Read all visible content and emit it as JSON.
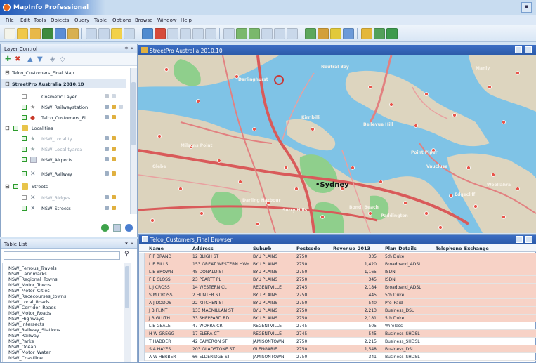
{
  "app": {
    "title": "MapInfo Professional",
    "accent": "#2b5aa8"
  },
  "menu": [
    "File",
    "Edit",
    "Tools",
    "Objects",
    "Query",
    "Table",
    "Options",
    "Browse",
    "Window",
    "Help"
  ],
  "layer_control": {
    "title": "Layer Control",
    "close_label": "✶ ×",
    "rows": [
      {
        "label": "Telco_Customers_Final Map"
      },
      {
        "label": "StreetPro Australia 2010.10"
      },
      {
        "label": "Cosmetic Layer"
      },
      {
        "label": "NSW_Railwaystation"
      },
      {
        "label": "Telco_Customers_Fi"
      },
      {
        "label": "Localities"
      },
      {
        "label": "NSW_Locality"
      },
      {
        "label": "NSW_Localityarea"
      },
      {
        "label": "NSW_Airports"
      },
      {
        "label": "NSW_Railway"
      },
      {
        "label": "Streets"
      },
      {
        "label": "NSW_Ridges"
      },
      {
        "label": "NSW_Streets"
      }
    ]
  },
  "table_list": {
    "title": "Table List",
    "close_label": "✶ ×",
    "items": [
      "NSW_Ferrous_Travels",
      "NSW_Landmarks",
      "NSW_Regional_Towns",
      "NSW_Motor_Towns",
      "NSW_Motor_Cities",
      "NSW_Racecourses_towns",
      "NSW_Local_Roads",
      "NSW_Corridor_Roads",
      "NSW_Motor_Roads",
      "NSW_Highways",
      "NSW_Intersects",
      "NSW_Railway_Stations",
      "NSW_Railway",
      "NSW_Parks",
      "NSW_Ocean",
      "NSW_Motor_Water",
      "NSW_Coastline"
    ]
  },
  "map": {
    "title": "StreetPro Australia 2010.10",
    "city_label": "•Sydney",
    "labels": [
      "Darlinghurst",
      "Point Piper",
      "Woollahra",
      "Neutral Bay",
      "Manly",
      "Vaucluse",
      "Darling Harbour",
      "Bondi Beach",
      "Paddington",
      "Glebe",
      "Kirribilli",
      "Milsons Point",
      "Edgecliff",
      "Bellevue Hill",
      "Surry Hills"
    ]
  },
  "browser": {
    "title": "Telco_Customers_Final Browser",
    "columns": [
      "Name",
      "Address",
      "Suburb",
      "Postcode",
      "Revenue_2013",
      "Plan_Details",
      "Telephone_Exchange"
    ],
    "rows": [
      [
        "F P BRAND",
        "12 BLIGH ST",
        "BYU PLAINS",
        "2750",
        "335",
        "5th Duke",
        "sel"
      ],
      [
        "L E BILLS",
        "153 GREAT WESTERN HWY",
        "BYU PLAINS",
        "2750",
        "1,420",
        "Broadband_ADSL",
        "sel"
      ],
      [
        "L E BROWN",
        "45 DONALD ST",
        "BYU PLAINS",
        "2750",
        "1,165",
        "ISDN",
        "sel"
      ],
      [
        "F E CLOSS",
        "23 PEARTT PL",
        "BYU PLAINS",
        "2750",
        "345",
        "ISDN",
        "sel"
      ],
      [
        "L J CROSS",
        "14 WESTERN CL",
        "REGENTVILLE",
        "2745",
        "2,184",
        "Broadband_ADSL",
        "sel"
      ],
      [
        "S M CROSS",
        "2 HUNTER ST",
        "BYU PLAINS",
        "2750",
        "445",
        "5th Duke",
        "sel"
      ],
      [
        "A J DODDS",
        "22 KITCHEN ST",
        "BYU PLAINS",
        "2750",
        "540",
        "Pre_Paid",
        "sel"
      ],
      [
        "J B FLINT",
        "133 MACMILLAN ST",
        "BYU PLAINS",
        "2750",
        "2,213",
        "Business_DSL",
        "sel"
      ],
      [
        "J B GLUTH",
        "33 SHEPPARD RD",
        "BYU PLAINS",
        "2750",
        "2,181",
        "5th Duke",
        "sel"
      ],
      [
        "L E GEALE",
        "47 WORRA CR",
        "REGENTVILLE",
        "2745",
        "505",
        "Wireless",
        "norm"
      ],
      [
        "H W GREGG",
        "17 ELERA CT",
        "REGENTVILLE",
        "2745",
        "545",
        "Business_SHDSL",
        "sel"
      ],
      [
        "T HADDER",
        "42 CAMERON ST",
        "JAMISONTOWN",
        "2750",
        "2,215",
        "Business_SHDSL",
        "norm"
      ],
      [
        "S A HAYES",
        "203 GLADSTONE ST",
        "GLENGARIE",
        "2750",
        "1,548",
        "Business_DSL",
        "sel"
      ],
      [
        "A W HERBER",
        "66 ELDERIDGE ST",
        "JAMISONTOWN",
        "2750",
        "341",
        "Business_SHDSL",
        "norm"
      ]
    ]
  }
}
